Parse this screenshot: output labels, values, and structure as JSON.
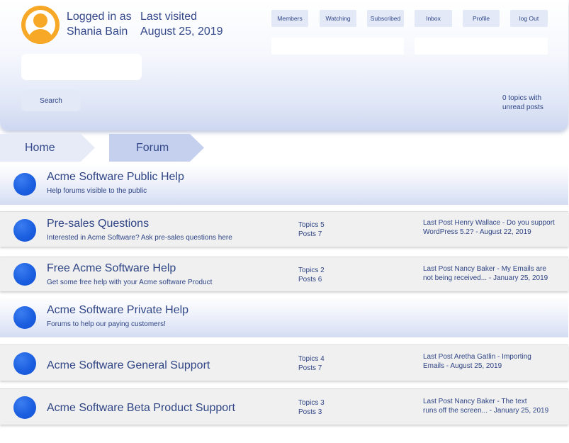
{
  "user": {
    "logged_in_label": "Logged in as",
    "name": "Shania Bain",
    "last_visited_label": "Last visited",
    "last_visited_date": "August 25, 2019"
  },
  "nav": {
    "members": "Members",
    "watching": "Watching",
    "subscribed": "Subscribed",
    "inbox": "Inbox",
    "profile": "Profile",
    "logout": "log Out"
  },
  "search": {
    "placeholder": "",
    "button_label": "Search"
  },
  "unread": {
    "line1": "0 topics with",
    "line2": "unread posts"
  },
  "breadcrumb": {
    "home": "Home",
    "forum": "Forum"
  },
  "categories": [
    {
      "title": "Acme Software Public Help",
      "description": "Help forums visible to the public"
    },
    {
      "title": "Acme Software Private Help",
      "description": "Forums to help our paying customers!"
    }
  ],
  "forums": [
    {
      "title": "Pre-sales Questions",
      "description": "Interested in Acme Software? Ask pre-sales questions here",
      "topics": "Topics 5",
      "posts": "Posts 7",
      "last_post_line1": "Last Post Henry Wallace - Do you support",
      "last_post_line2": "WordPress 5.2? - August 22, 2019"
    },
    {
      "title": "Free Acme Software Help",
      "description": "Get some free help with your Acme software Product",
      "topics": "Topics 2",
      "posts": "Posts 6",
      "last_post_line1": "Last Post Nancy Baker - My Emails are",
      "last_post_line2": "not being received... - January 25, 2019"
    },
    {
      "title": "Acme Software General Support",
      "description": "",
      "topics": "Topics 4",
      "posts": "Posts 7",
      "last_post_line1": "Last Post Aretha Gatlin - Importing",
      "last_post_line2": "Emails - August 25, 2019"
    },
    {
      "title": "Acme Software Beta Product Support",
      "description": "",
      "topics": "Topics 3",
      "posts": "Posts 3",
      "last_post_line1": "Last Post Nancy Baker - The text",
      "last_post_line2": "runs off the screen... - January 25, 2019"
    }
  ],
  "colors": {
    "text": "#2f4585",
    "avatar": "#f6a826",
    "forum_dot": "#1b5fe0",
    "button_bg": "#e3e9f7",
    "breadcrumb_active": "#c4d0ee",
    "breadcrumb_inactive": "#e6ebf7",
    "forum_row_bg": "#f0f0f0"
  }
}
